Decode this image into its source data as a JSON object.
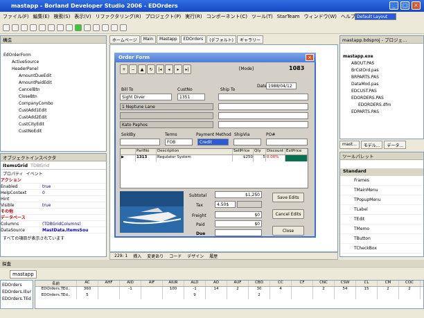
{
  "window": {
    "title": "mastapp - Borland Developer Studio 2006 - EDOrders"
  },
  "menu": [
    "ファイル(F)",
    "編集(E)",
    "検索(S)",
    "表示(V)",
    "リファクタリング(R)",
    "プロジェクト(P)",
    "実行(R)",
    "コンポーネント(C)",
    "ツール(T)",
    "StarTeam",
    "ウィンドウ(W)",
    "ヘルプ(H)"
  ],
  "layout_select": "Default Layout",
  "left_panel": {
    "title": "構造",
    "tree": [
      "EdOrderForm",
      "ActiveSource",
      "HeaderPanel",
      "AmountDueEdit",
      "AmountPaidEdit",
      "CancelBtn",
      "CloseBtn",
      "CompanyCombo",
      "CustAdd1Edit",
      "CustAdd2Edit",
      "CustCityEdit",
      "CustNoEdit"
    ]
  },
  "inspector": {
    "title": "オブジェクトインスペクタ",
    "selected": "ItemsGrid",
    "selected_type": "TDBGrid",
    "tabs": [
      "プロパティ",
      "イベント"
    ],
    "rows": [
      [
        "アクション",
        ""
      ],
      [
        "Enabled",
        "true"
      ],
      [
        "HelpContext",
        "0"
      ],
      [
        "Hint",
        ""
      ],
      [
        "Visible",
        "true"
      ],
      [
        "その他",
        ""
      ],
      [
        "データベース",
        ""
      ],
      [
        "Columns",
        "(TDBGridColumns)"
      ],
      [
        "DataSource",
        "MastData.ItemsSou"
      ]
    ],
    "footer": "すべての項目が表示されています"
  },
  "tabs": [
    "ホームページ",
    "Main",
    "Mastapp",
    "EDOrders",
    "(デフォルト)",
    "ギャラリー"
  ],
  "form": {
    "title": "Order Form",
    "mode": "[Mode]",
    "order_no": "1083",
    "bill_to_label": "Bill To",
    "custno_label": "CustNo",
    "ship_to_label": "Ship To",
    "date_label": "Date",
    "date": "1988/04/12",
    "company": "Sight Diver",
    "custno": "1351",
    "address": "1 Neptune Lane",
    "city": "Kato Paphos",
    "soldby_label": "SoldBy",
    "terms_label": "Terms",
    "payment_label": "Payment Method",
    "shipvia_label": "ShipVia",
    "po_label": "PO#",
    "terms": "FOB",
    "payment": "Credit",
    "grid_headers": [
      "PartNo",
      "Description",
      "SellPrice",
      "Qty",
      "Discount",
      "ExtPrice"
    ],
    "grid_row": [
      "1313",
      "Regulator System",
      "$250",
      "5",
      "0.00%",
      ""
    ],
    "subtotal_label": "Subtotal",
    "subtotal": "$1,250",
    "tax_label": "Tax",
    "tax": "4.50$",
    "freight_label": "Freight",
    "freight": "$0",
    "paid_label": "Paid",
    "paid": "$0",
    "due_label": "Due",
    "save": "Save Edits",
    "cancel": "Cancel Edits",
    "close": "Close"
  },
  "statusbar": {
    "pos": "229: 1",
    "mode": "挿入",
    "modified": "変更あり",
    "tabs": [
      "コード",
      "デザイン",
      "履歴"
    ]
  },
  "project": {
    "title": "mastapp.bdsproj - プロジェ...",
    "tree": [
      "mastapp.exe",
      "ABOUT.PAS",
      "BrCstOrd.pas",
      "BRPARTS.PAS",
      "DataMod.pas",
      "EDCUST.PAS",
      "EDORDERS.PAS",
      "EDORDERS.dfm",
      "EDPARTS.PAS"
    ],
    "tabs": [
      "mast...",
      "モデル...",
      "データ..."
    ]
  },
  "palette": {
    "title": "ツールパレット",
    "category": "Standard",
    "items": [
      "Frames",
      "TMainMenu",
      "TPopupMenu",
      "TLabel",
      "TEdit",
      "TMemo",
      "TButton",
      "TCheckBox"
    ]
  },
  "bottom": {
    "title": "探査",
    "tab": "mastapp",
    "tree": [
      "EDOrders",
      "EDOrders.Illum\\class",
      "EDOrders.TEdOrderForm"
    ],
    "headers": [
      "名前",
      "AC",
      "AHF",
      "AID",
      "AIF",
      "AIUR",
      "ALD",
      "AO",
      "AUF",
      "CBO",
      "CC",
      "CF",
      "CNC",
      "CSW",
      "CL",
      "CM",
      "COC"
    ],
    "rows": [
      [
        "EDOrders.TEd..",
        "360",
        "",
        "-1",
        "",
        "100",
        "-1",
        "14",
        "2",
        "30",
        "4",
        "",
        "2",
        "54",
        "15",
        "2",
        "2"
      ],
      [
        "EDOrders.TEd..",
        "5",
        "",
        "",
        "",
        "",
        "9",
        "",
        "",
        "2",
        "",
        "",
        "",
        "",
        "",
        "",
        ""
      ]
    ]
  }
}
